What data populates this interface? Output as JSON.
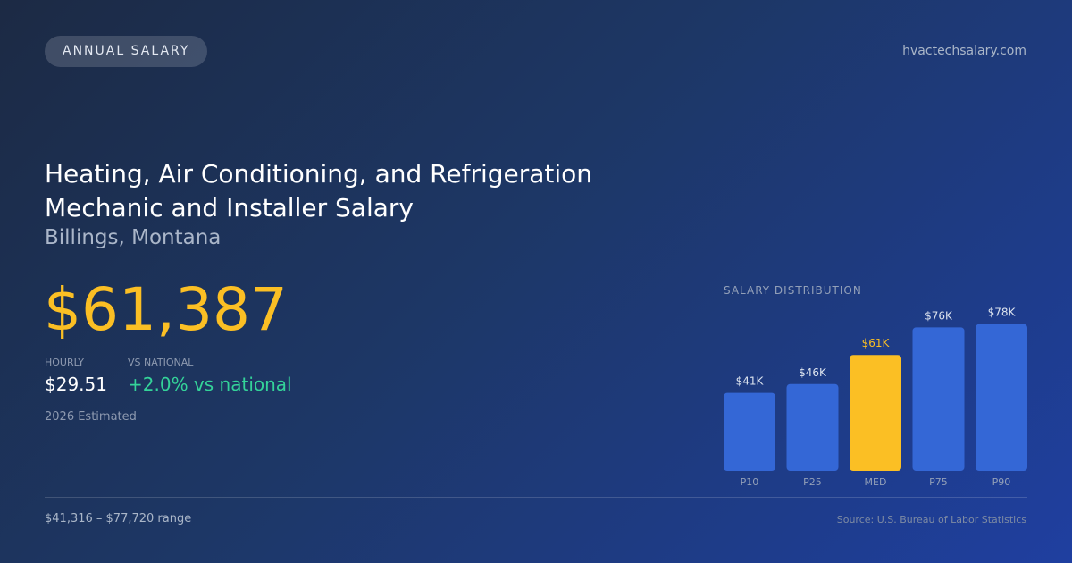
{
  "badge": "ANNUAL SALARY",
  "site": "hvactechsalary.com",
  "title_lines": [
    "Heating, Air Conditioning, and Refrigeration",
    "Mechanic and Installer Salary"
  ],
  "location": "Billings, Montana",
  "salary": "$61,387",
  "hourly": {
    "label": "HOURLY",
    "value": "$29.51"
  },
  "national": {
    "label": "VS NATIONAL",
    "value": "+2.0% vs national"
  },
  "note": "2026 Estimated",
  "range": "$41,316 – $77,720 range",
  "source": "Source: U.S. Bureau of Labor Statistics",
  "colors": {
    "accent": "#fbbf24",
    "bar": "#3467d6",
    "positive": "#34d399"
  },
  "chart_data": {
    "type": "bar",
    "title": "SALARY DISTRIBUTION",
    "categories": [
      "P10",
      "P25",
      "MED",
      "P75",
      "P90"
    ],
    "values": [
      41316,
      46000,
      61387,
      76000,
      77720
    ],
    "data_labels": [
      "$41K",
      "$46K",
      "$61K",
      "$76K",
      "$78K"
    ],
    "highlight": "MED",
    "ylim": [
      0,
      79000
    ],
    "grid": false,
    "legend": "none"
  }
}
